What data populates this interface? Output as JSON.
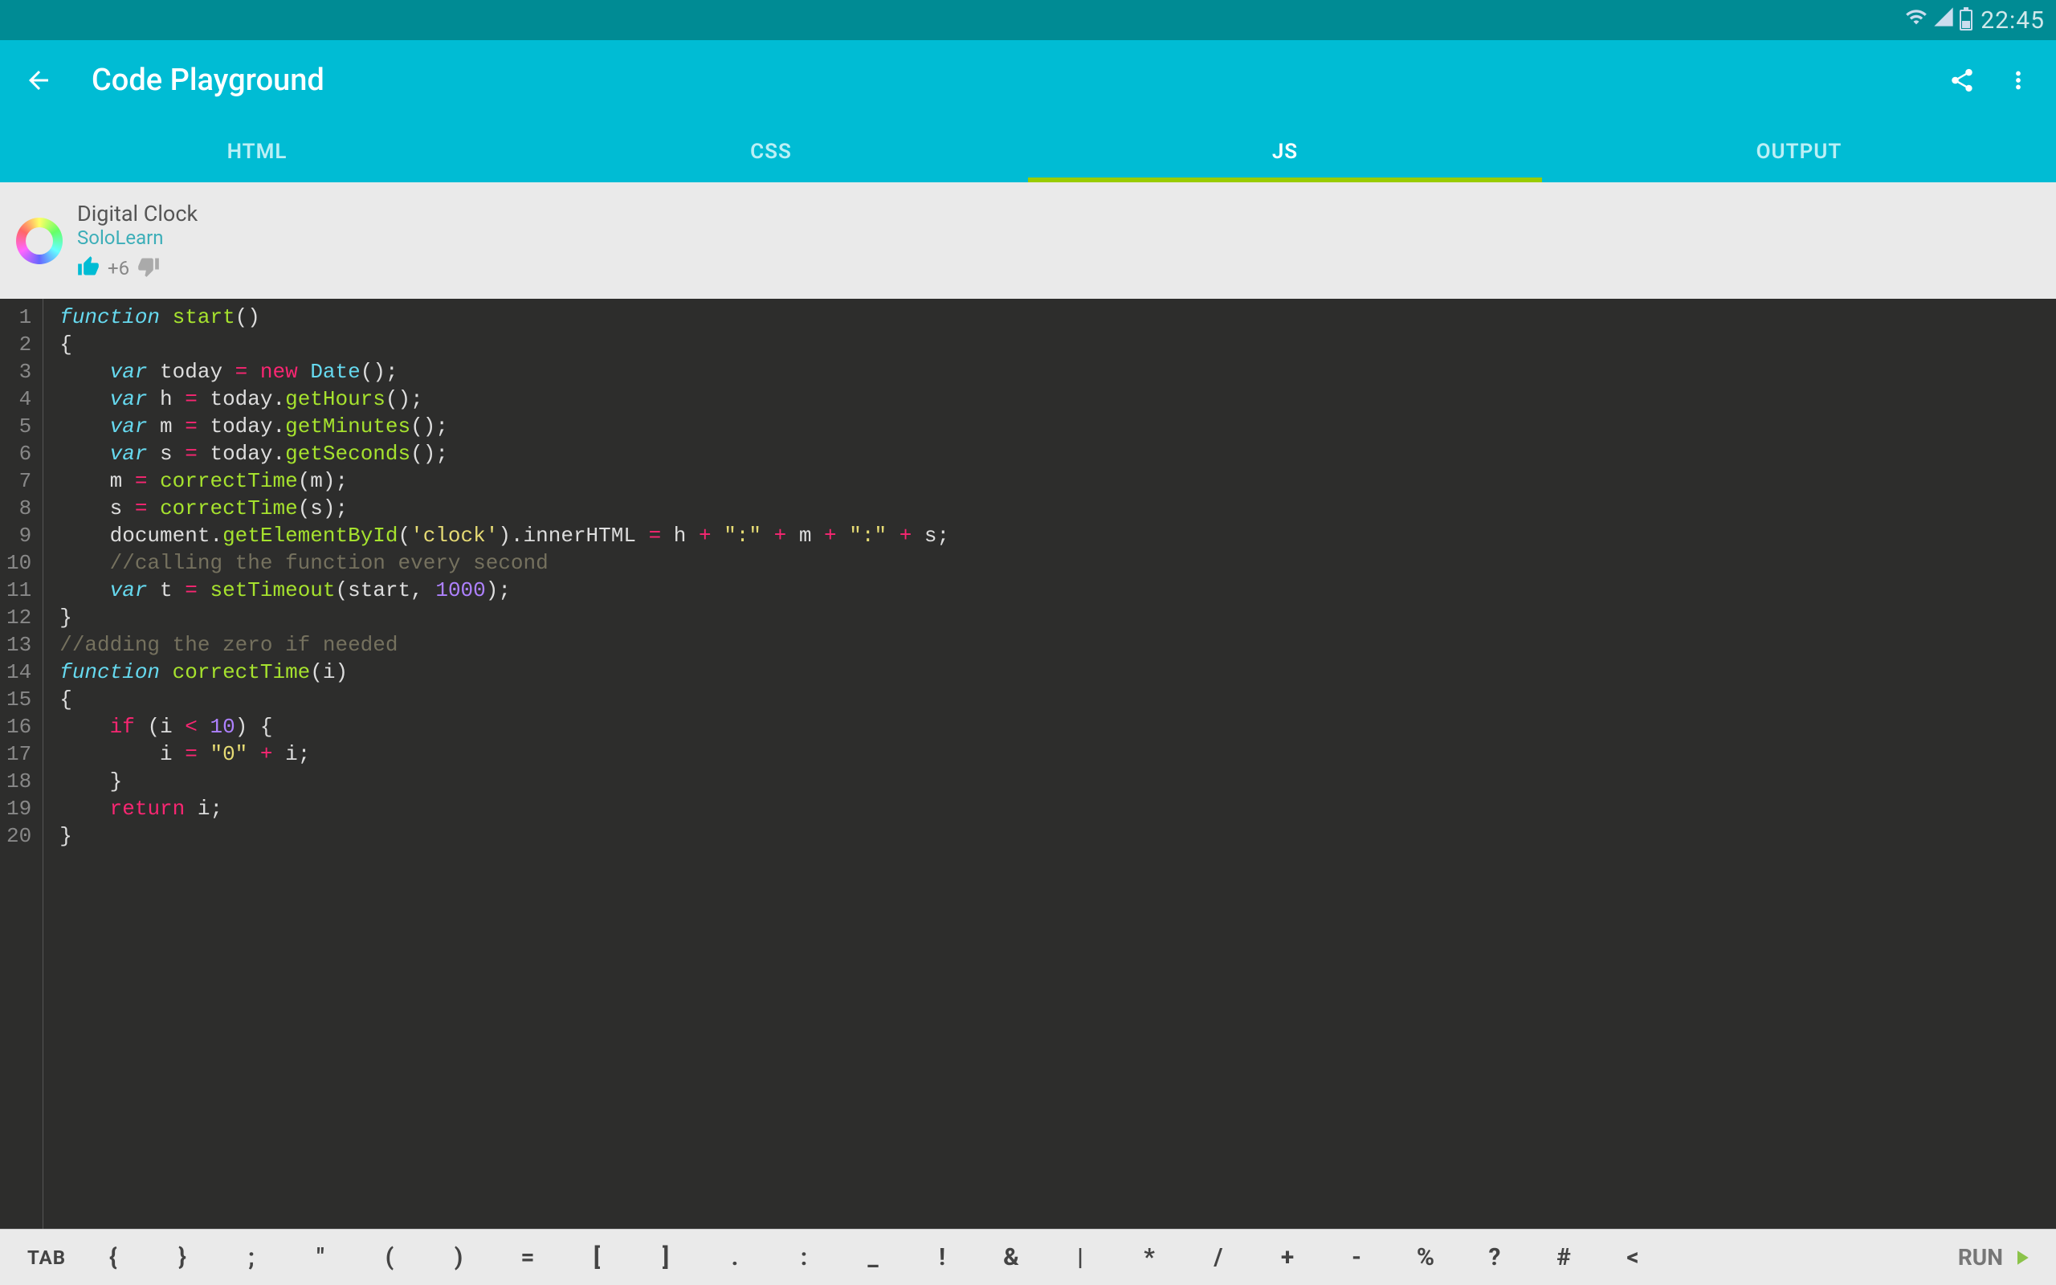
{
  "status": {
    "time": "22:45"
  },
  "app": {
    "title": "Code Playground"
  },
  "tabs": [
    {
      "label": "HTML",
      "active": false
    },
    {
      "label": "CSS",
      "active": false
    },
    {
      "label": "JS",
      "active": true
    },
    {
      "label": "OUTPUT",
      "active": false
    }
  ],
  "project": {
    "title": "Digital Clock",
    "author": "SoloLearn",
    "votes": "+6"
  },
  "code": {
    "lines": [
      {
        "n": "1",
        "tokens": [
          {
            "c": "kw",
            "t": "function"
          },
          {
            "c": "",
            "t": " "
          },
          {
            "c": "fn",
            "t": "start"
          },
          {
            "c": "",
            "t": "()"
          }
        ]
      },
      {
        "n": "2",
        "tokens": [
          {
            "c": "",
            "t": "{"
          }
        ]
      },
      {
        "n": "3",
        "tokens": [
          {
            "c": "",
            "t": "    "
          },
          {
            "c": "kw",
            "t": "var"
          },
          {
            "c": "",
            "t": " today "
          },
          {
            "c": "op",
            "t": "="
          },
          {
            "c": "",
            "t": " "
          },
          {
            "c": "op",
            "t": "new"
          },
          {
            "c": "",
            "t": " "
          },
          {
            "c": "type",
            "t": "Date"
          },
          {
            "c": "",
            "t": "();"
          }
        ]
      },
      {
        "n": "4",
        "tokens": [
          {
            "c": "",
            "t": "    "
          },
          {
            "c": "kw",
            "t": "var"
          },
          {
            "c": "",
            "t": " h "
          },
          {
            "c": "op",
            "t": "="
          },
          {
            "c": "",
            "t": " today."
          },
          {
            "c": "fn",
            "t": "getHours"
          },
          {
            "c": "",
            "t": "();"
          }
        ]
      },
      {
        "n": "5",
        "tokens": [
          {
            "c": "",
            "t": "    "
          },
          {
            "c": "kw",
            "t": "var"
          },
          {
            "c": "",
            "t": " m "
          },
          {
            "c": "op",
            "t": "="
          },
          {
            "c": "",
            "t": " today."
          },
          {
            "c": "fn",
            "t": "getMinutes"
          },
          {
            "c": "",
            "t": "();"
          }
        ]
      },
      {
        "n": "6",
        "tokens": [
          {
            "c": "",
            "t": "    "
          },
          {
            "c": "kw",
            "t": "var"
          },
          {
            "c": "",
            "t": " s "
          },
          {
            "c": "op",
            "t": "="
          },
          {
            "c": "",
            "t": " today."
          },
          {
            "c": "fn",
            "t": "getSeconds"
          },
          {
            "c": "",
            "t": "();"
          }
        ]
      },
      {
        "n": "7",
        "tokens": [
          {
            "c": "",
            "t": "    m "
          },
          {
            "c": "op",
            "t": "="
          },
          {
            "c": "",
            "t": " "
          },
          {
            "c": "fn",
            "t": "correctTime"
          },
          {
            "c": "",
            "t": "(m);"
          }
        ]
      },
      {
        "n": "8",
        "tokens": [
          {
            "c": "",
            "t": "    s "
          },
          {
            "c": "op",
            "t": "="
          },
          {
            "c": "",
            "t": " "
          },
          {
            "c": "fn",
            "t": "correctTime"
          },
          {
            "c": "",
            "t": "(s);"
          }
        ]
      },
      {
        "n": "9",
        "tokens": [
          {
            "c": "",
            "t": "    document."
          },
          {
            "c": "fn",
            "t": "getElementById"
          },
          {
            "c": "",
            "t": "("
          },
          {
            "c": "str",
            "t": "'clock'"
          },
          {
            "c": "",
            "t": ").innerHTML "
          },
          {
            "c": "op",
            "t": "="
          },
          {
            "c": "",
            "t": " h "
          },
          {
            "c": "op",
            "t": "+"
          },
          {
            "c": "",
            "t": " "
          },
          {
            "c": "str",
            "t": "\":\""
          },
          {
            "c": "",
            "t": " "
          },
          {
            "c": "op",
            "t": "+"
          },
          {
            "c": "",
            "t": " m "
          },
          {
            "c": "op",
            "t": "+"
          },
          {
            "c": "",
            "t": " "
          },
          {
            "c": "str",
            "t": "\":\""
          },
          {
            "c": "",
            "t": " "
          },
          {
            "c": "op",
            "t": "+"
          },
          {
            "c": "",
            "t": " s;"
          }
        ]
      },
      {
        "n": "10",
        "tokens": [
          {
            "c": "",
            "t": "    "
          },
          {
            "c": "cmt",
            "t": "//calling the function every second"
          }
        ]
      },
      {
        "n": "11",
        "tokens": [
          {
            "c": "",
            "t": "    "
          },
          {
            "c": "kw",
            "t": "var"
          },
          {
            "c": "",
            "t": " t "
          },
          {
            "c": "op",
            "t": "="
          },
          {
            "c": "",
            "t": " "
          },
          {
            "c": "fn",
            "t": "setTimeout"
          },
          {
            "c": "",
            "t": "(start, "
          },
          {
            "c": "num",
            "t": "1000"
          },
          {
            "c": "",
            "t": ");"
          }
        ]
      },
      {
        "n": "12",
        "tokens": [
          {
            "c": "",
            "t": "}"
          }
        ]
      },
      {
        "n": "13",
        "tokens": [
          {
            "c": "cmt",
            "t": "//adding the zero if needed"
          }
        ]
      },
      {
        "n": "14",
        "tokens": [
          {
            "c": "kw",
            "t": "function"
          },
          {
            "c": "",
            "t": " "
          },
          {
            "c": "fn",
            "t": "correctTime"
          },
          {
            "c": "",
            "t": "(i)"
          }
        ]
      },
      {
        "n": "15",
        "tokens": [
          {
            "c": "",
            "t": "{"
          }
        ]
      },
      {
        "n": "16",
        "tokens": [
          {
            "c": "",
            "t": "    "
          },
          {
            "c": "op",
            "t": "if"
          },
          {
            "c": "",
            "t": " (i "
          },
          {
            "c": "op",
            "t": "<"
          },
          {
            "c": "",
            "t": " "
          },
          {
            "c": "num",
            "t": "10"
          },
          {
            "c": "",
            "t": ") {"
          }
        ]
      },
      {
        "n": "17",
        "tokens": [
          {
            "c": "",
            "t": "        i "
          },
          {
            "c": "op",
            "t": "="
          },
          {
            "c": "",
            "t": " "
          },
          {
            "c": "str",
            "t": "\"0\""
          },
          {
            "c": "",
            "t": " "
          },
          {
            "c": "op",
            "t": "+"
          },
          {
            "c": "",
            "t": " i;"
          }
        ]
      },
      {
        "n": "18",
        "tokens": [
          {
            "c": "",
            "t": "    }"
          }
        ]
      },
      {
        "n": "19",
        "tokens": [
          {
            "c": "",
            "t": "    "
          },
          {
            "c": "op",
            "t": "return"
          },
          {
            "c": "",
            "t": " i;"
          }
        ]
      },
      {
        "n": "20",
        "tokens": [
          {
            "c": "",
            "t": "}"
          }
        ]
      }
    ]
  },
  "keys": [
    "TAB",
    "{",
    "}",
    ";",
    "\"",
    "(",
    ")",
    "=",
    "[",
    "]",
    ".",
    ":",
    "_",
    "!",
    "&",
    "|",
    "*",
    "/",
    "+",
    "-",
    "%",
    "?",
    "#",
    "<"
  ],
  "run_label": "RUN"
}
